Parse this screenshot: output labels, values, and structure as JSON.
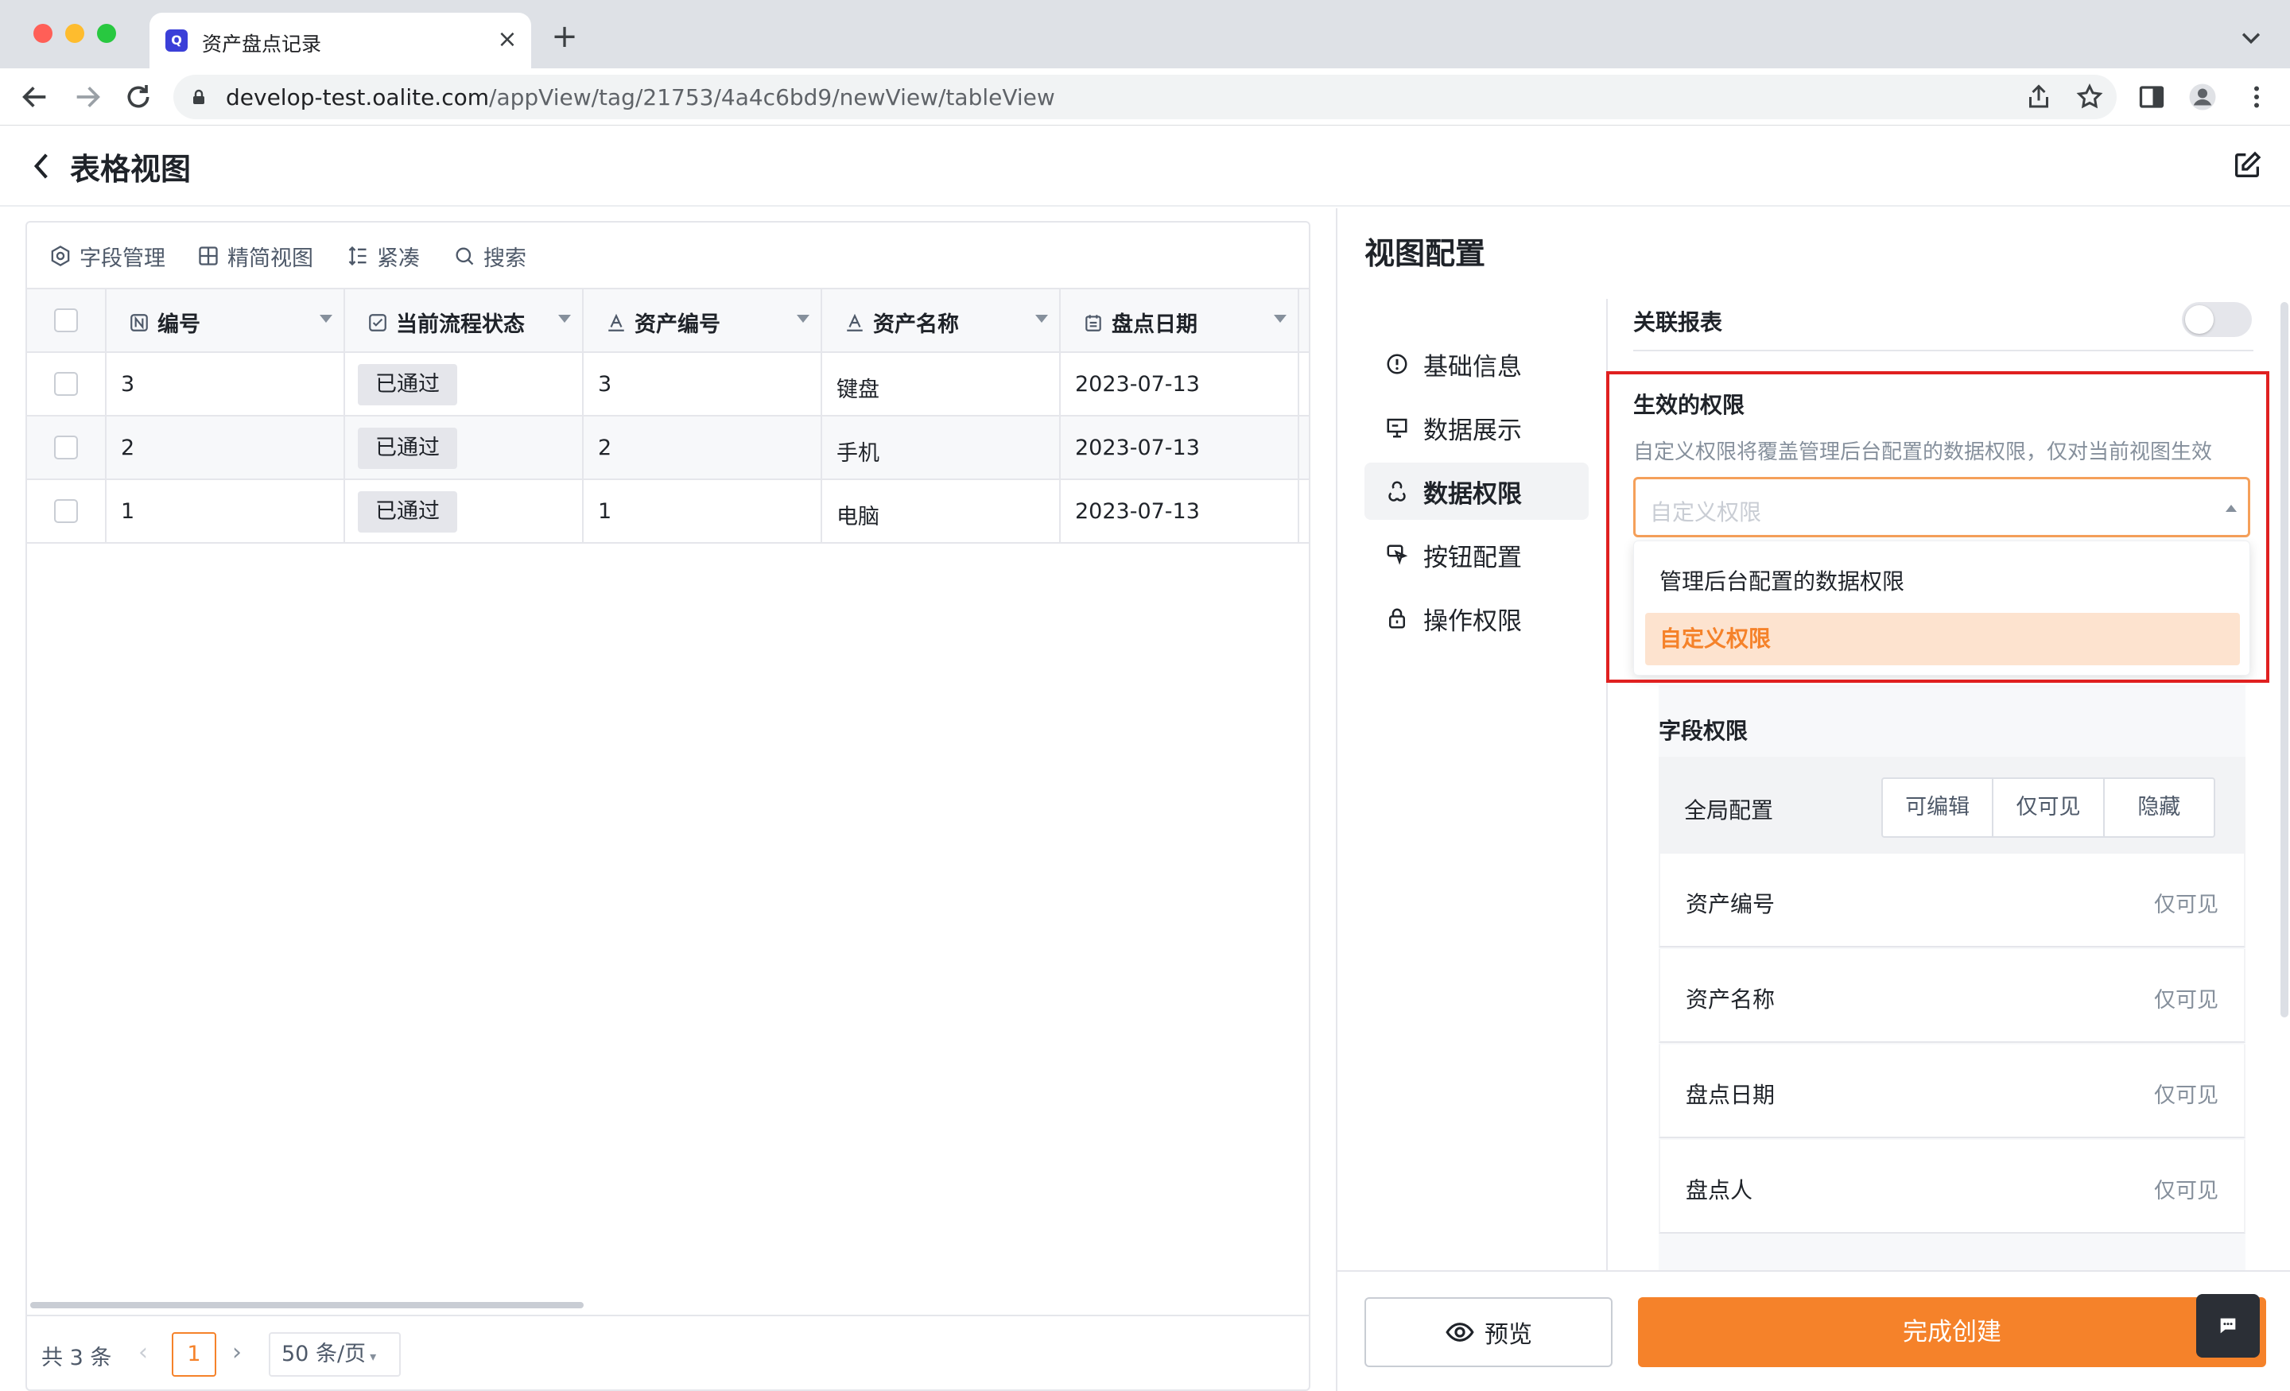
{
  "browser": {
    "tab_title": "资产盘点记录",
    "favicon_letter": "Q",
    "url_host": "develop-test.oalite.com",
    "url_path": "/appView/tag/21753/4a4c6bd9/newView/tableView"
  },
  "header": {
    "title": "表格视图"
  },
  "toolbar": {
    "field_manage": "字段管理",
    "compact_view": "精简视图",
    "density": "紧凑",
    "search": "搜索"
  },
  "table": {
    "columns": [
      "编号",
      "当前流程状态",
      "资产编号",
      "资产名称",
      "盘点日期"
    ],
    "rows": [
      {
        "id": "3",
        "status": "已通过",
        "asset_no": "3",
        "asset_name": "键盘",
        "date": "2023-07-13"
      },
      {
        "id": "2",
        "status": "已通过",
        "asset_no": "2",
        "asset_name": "手机",
        "date": "2023-07-13"
      },
      {
        "id": "1",
        "status": "已通过",
        "asset_no": "1",
        "asset_name": "电脑",
        "date": "2023-07-13"
      }
    ]
  },
  "pager": {
    "total": "共 3 条",
    "current_page": "1",
    "page_size": "50 条/页"
  },
  "config": {
    "title": "视图配置",
    "nav": [
      "基础信息",
      "数据展示",
      "数据权限",
      "按钮配置",
      "操作权限"
    ],
    "active_nav": "数据权限",
    "linked_report_label": "关联报表",
    "linked_report_enabled": false,
    "permission_title": "生效的权限",
    "permission_desc": "自定义权限将覆盖管理后台配置的数据权限，仅对当前视图生效",
    "select_placeholder": "自定义权限",
    "options": [
      "管理后台配置的数据权限",
      "自定义权限"
    ],
    "highlighted_option": "自定义权限",
    "field_perm_title": "字段权限",
    "global_label": "全局配置",
    "segments": [
      "可编辑",
      "仅可见",
      "隐藏"
    ],
    "fields": [
      {
        "name": "资产编号",
        "perm": "仅可见"
      },
      {
        "name": "资产名称",
        "perm": "仅可见"
      },
      {
        "name": "盘点日期",
        "perm": "仅可见"
      },
      {
        "name": "盘点人",
        "perm": "仅可见"
      }
    ],
    "preview_label": "预览",
    "finish_label": "完成创建"
  },
  "colors": {
    "accent": "#f5822a",
    "highlight_border": "#e02020",
    "selected_option_bg": "#fde3cf"
  }
}
